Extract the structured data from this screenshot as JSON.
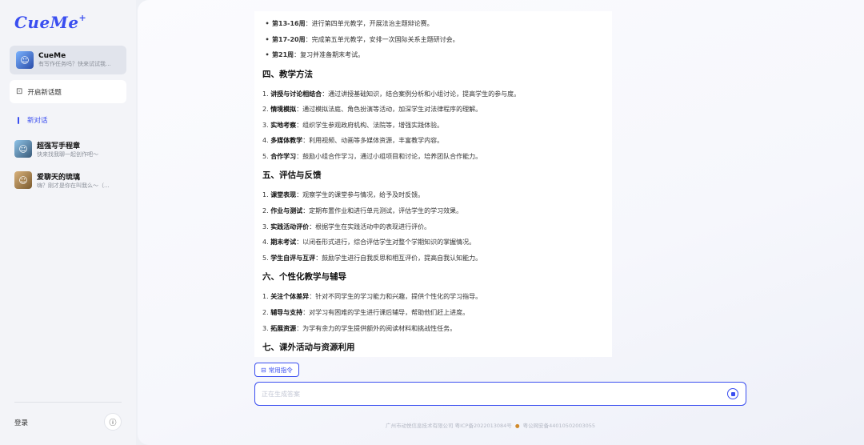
{
  "sidebar": {
    "logo": "CueMe",
    "logo_spark": "+",
    "agent": {
      "name": "CueMe",
      "subtitle": "有写作任务吗？快来试试我..."
    },
    "new_topic_label": "开启新话题",
    "new_chat_label": "新对话",
    "chats": [
      {
        "title": "超强写手程章",
        "subtitle": "快来找我聊一起创作吧～"
      },
      {
        "title": "爱聊天的琉璃",
        "subtitle": "嗨？刚才是你在叫我么～（..."
      }
    ],
    "login_label": "登录"
  },
  "content": {
    "schedule": [
      {
        "week": "第13-16周",
        "text": "：进行第四单元教学，开展法治主题辩论赛。"
      },
      {
        "week": "第17-20周",
        "text": "：完成第五单元教学，安排一次国际关系主题研讨会。"
      },
      {
        "week": "第21周",
        "text": "：复习并准备期末考试。"
      }
    ],
    "sections": [
      {
        "title": "四、教学方法",
        "items": [
          {
            "n": "1.",
            "bold": "讲授与讨论相结合",
            "text": "：通过讲授基础知识，结合案例分析和小组讨论，提高学生的参与度。"
          },
          {
            "n": "2.",
            "bold": "情境模拟",
            "text": "：通过模拟法庭、角色扮演等活动，加深学生对法律程序的理解。"
          },
          {
            "n": "3.",
            "bold": "实地考察",
            "text": "：组织学生参观政府机构、法院等，增强实践体验。"
          },
          {
            "n": "4.",
            "bold": "多媒体教学",
            "text": "：利用视频、动画等多媒体资源，丰富教学内容。"
          },
          {
            "n": "5.",
            "bold": "合作学习",
            "text": "：鼓励小组合作学习，通过小组项目和讨论，培养团队合作能力。"
          }
        ]
      },
      {
        "title": "五、评估与反馈",
        "items": [
          {
            "n": "1.",
            "bold": "课堂表现",
            "text": "：观察学生的课堂参与情况，给予及时反馈。"
          },
          {
            "n": "2.",
            "bold": "作业与测试",
            "text": "：定期布置作业和进行单元测试，评估学生的学习效果。"
          },
          {
            "n": "3.",
            "bold": "实践活动评价",
            "text": "：根据学生在实践活动中的表现进行评价。"
          },
          {
            "n": "4.",
            "bold": "期末考试",
            "text": "：以闭卷形式进行，综合评估学生对整个学期知识的掌握情况。"
          },
          {
            "n": "5.",
            "bold": "学生自评与互评",
            "text": "：鼓励学生进行自我反思和相互评价，提高自我认知能力。"
          }
        ]
      },
      {
        "title": "六、个性化教学与辅导",
        "items": [
          {
            "n": "1.",
            "bold": "关注个体差异",
            "text": "：针对不同学生的学习能力和兴趣，提供个性化的学习指导。"
          },
          {
            "n": "2.",
            "bold": "辅导与支持",
            "text": "：对学习有困难的学生进行课后辅导，帮助他们赶上进度。"
          },
          {
            "n": "3.",
            "bold": "拓展资源",
            "text": "：为学有余力的学生提供额外的阅读材料和挑战性任务。"
          }
        ]
      },
      {
        "title": "七、课外活动与资源利用",
        "items": []
      }
    ]
  },
  "composer": {
    "command_label": "常用指令",
    "placeholder": "正在生成答案"
  },
  "footer": {
    "company": "广州市动悦信息技术有限公司 粤ICP备2022013084号",
    "police": "粤公网安备44010502003055"
  }
}
